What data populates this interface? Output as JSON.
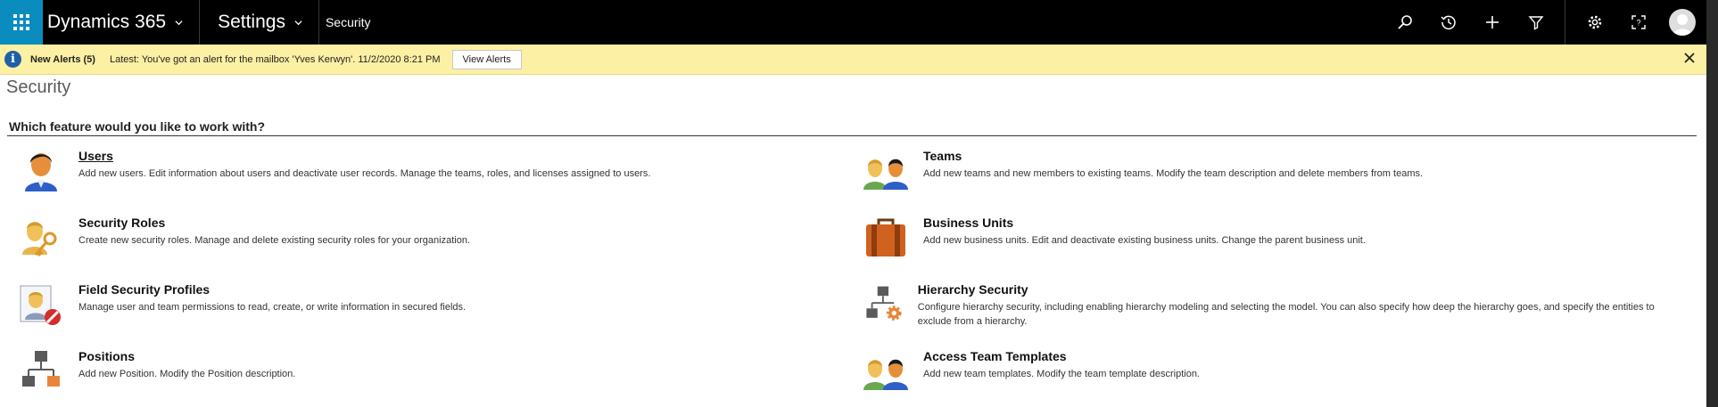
{
  "nav": {
    "app_name": "Dynamics 365",
    "area": "Settings",
    "breadcrumb": "Security",
    "icons": [
      "search-icon",
      "recent-icon",
      "new-icon",
      "filter-icon",
      "settings-icon",
      "help-icon",
      "avatar"
    ]
  },
  "alert": {
    "title": "New Alerts (5)",
    "message": "Latest: You've got an alert for the mailbox 'Yves Kerwyn'. 11/2/2020 8:21 PM",
    "button": "View Alerts",
    "close": "✕"
  },
  "page": {
    "title": "Security",
    "question": "Which feature would you like to work with?"
  },
  "features": [
    {
      "title": "Users",
      "desc": "Add new users. Edit information about users and deactivate user records. Manage the teams, roles, and licenses assigned to users.",
      "icon": "user-icon"
    },
    {
      "title": "Teams",
      "desc": "Add new teams and new members to existing teams. Modify the team description and delete members from teams.",
      "icon": "team-icon"
    },
    {
      "title": "Security Roles",
      "desc": "Create new security roles. Manage and delete existing security roles for your organization.",
      "icon": "security-role-icon"
    },
    {
      "title": "Business Units",
      "desc": "Add new business units. Edit and deactivate existing business units. Change the parent business unit.",
      "icon": "briefcase-icon"
    },
    {
      "title": "Field Security Profiles",
      "desc": "Manage user and team permissions to read, create, or write information in secured fields.",
      "icon": "field-security-icon"
    },
    {
      "title": "Hierarchy Security",
      "desc": "Configure hierarchy security, including enabling hierarchy modeling and selecting the model. You can also specify how deep the hierarchy goes, and specify the entities to exclude from a hierarchy.",
      "icon": "hierarchy-gear-icon"
    },
    {
      "title": "Positions",
      "desc": "Add new Position. Modify the Position description.",
      "icon": "hierarchy-icon"
    },
    {
      "title": "Access Team Templates",
      "desc": "Add new team templates. Modify the team template description.",
      "icon": "team-template-icon"
    }
  ]
}
